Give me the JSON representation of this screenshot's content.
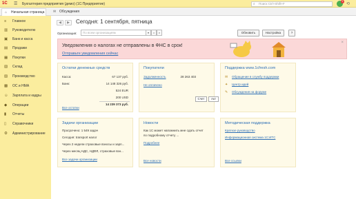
{
  "titlebar": {
    "logo": "1С",
    "menu_icon": "hamburger-icon",
    "title": "Бухгалтерия предприятия (демо)  (1С:Предприятие)",
    "search_placeholder": "Поиск Ctrl+Shift+F",
    "notif_count": "1"
  },
  "tabs": [
    {
      "label": "Начальная страница"
    },
    {
      "label": "Обсуждения"
    }
  ],
  "sidebar": {
    "items": [
      {
        "label": "Главное",
        "icon": "menu-icon"
      },
      {
        "label": "Руководителю",
        "icon": "chart-icon"
      },
      {
        "label": "Банк и касса",
        "icon": "bank-icon"
      },
      {
        "label": "Продажи",
        "icon": "cart-icon"
      },
      {
        "label": "Покупки",
        "icon": "basket-icon"
      },
      {
        "label": "Склад",
        "icon": "warehouse-icon"
      },
      {
        "label": "Производство",
        "icon": "factory-icon"
      },
      {
        "label": "ОС и НМА",
        "icon": "building-icon"
      },
      {
        "label": "Зарплата и кадры",
        "icon": "people-icon"
      },
      {
        "label": "Операции",
        "icon": "operations-icon"
      },
      {
        "label": "Отчеты",
        "icon": "reports-icon"
      },
      {
        "label": "Справочники",
        "icon": "book-icon"
      },
      {
        "label": "Администрирование",
        "icon": "gear-icon"
      }
    ]
  },
  "main": {
    "title": "Сегодня: 1 сентября, пятница",
    "org_label": "Организация:",
    "org_placeholder": "По всем организациям",
    "refresh_label": "Обновить",
    "settings_label": "Настройка",
    "help_label": "?"
  },
  "banner": {
    "title": "Уведомления о налогах не отправлены в ФНС в срок!",
    "link": "Отправьте уведомления сейчас"
  },
  "cash": {
    "title": "Остатки денежных средств",
    "rows": [
      {
        "label": "Касса:",
        "value": "67 137 руб."
      },
      {
        "label": "Банк:",
        "value": "14 148 326 руб."
      },
      {
        "label": "",
        "value": "524 EUR"
      },
      {
        "label": "",
        "value": "200 USD"
      }
    ],
    "total": "14 239 373 руб.",
    "link": "Все остатки"
  },
  "buyers": {
    "title": "Покупатели",
    "debt_label": "Задолженность",
    "debt_value": "28 263 403",
    "overdue_label": "Не оплачено",
    "buttons": [
      "Счет",
      "Акт",
      "Накладная",
      "УПД ▾"
    ]
  },
  "support": {
    "title": "Поддержка www.1cfresh.com",
    "links": [
      "Обращение в службу поддержки",
      "Центр идей",
      "Обсуждения на форуме"
    ]
  },
  "tasks": {
    "title": "Задачи организации",
    "items": [
      "Просрочено: 1 549 задач",
      "Сегодня: transport налог",
      "Через 2 недели страховые взносы и зарп...",
      "Через месяц НДС, НДФЛ, страховые взн..."
    ],
    "link": "Все задачи организации"
  },
  "news": {
    "title": "Новости",
    "text1": "Как 1С может напомнить мне сдать отчет",
    "text2": "по подробному отчету ...",
    "more": "Подробнее",
    "link": "Все новости"
  },
  "method": {
    "title": "Методическая поддержка",
    "links": [
      "Краткое руководство",
      "Информационная система 1С:ИТС"
    ],
    "link": "Все ссылки"
  }
}
